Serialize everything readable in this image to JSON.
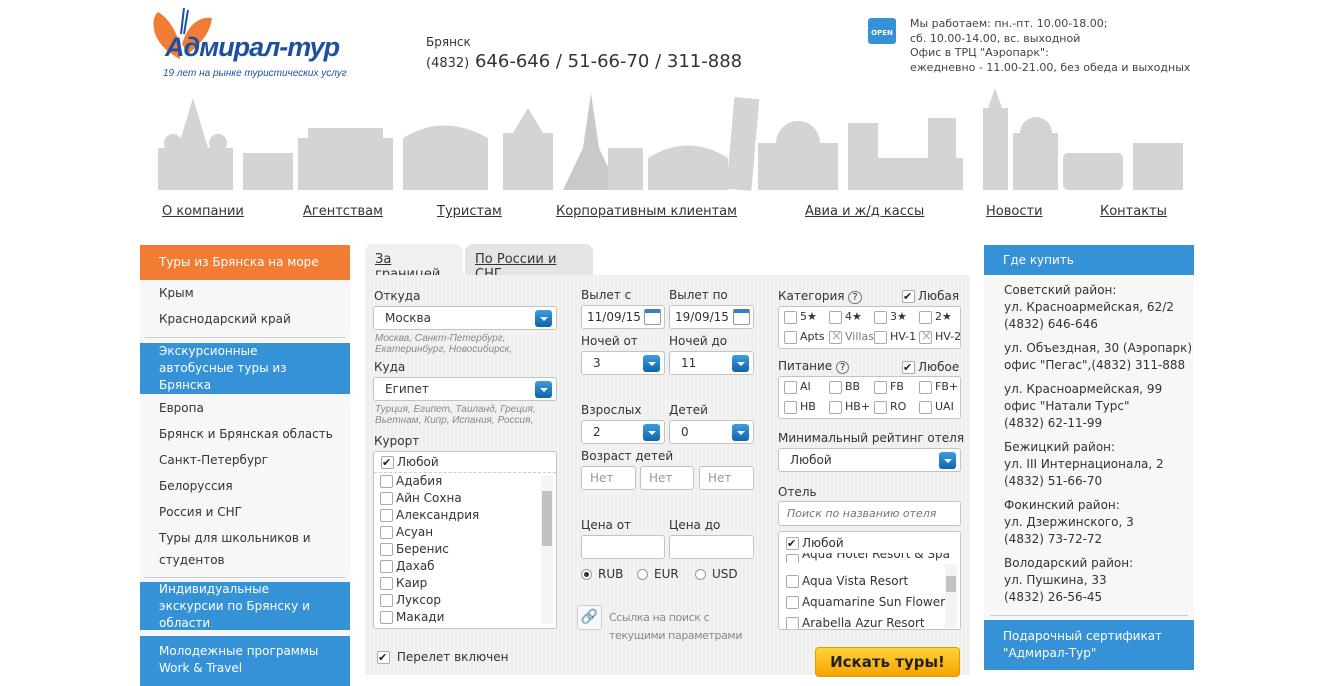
{
  "header": {
    "logo_text": "Адмирал-тур",
    "slogan": "19 лет на рынке туристических услуг",
    "city": "Брянск",
    "phone_code": "(4832)",
    "phones": "646-646 / 51-66-70 / 311-888",
    "open_badge": "OPEN",
    "hours": [
      "Мы работаем: пн.-пт. 10.00-18.00;",
      "сб. 10.00-14.00, вс. выходной",
      "Офис в ТРЦ \"Аэропарк\":",
      "ежедневно - 11.00-21.00, без обеда и выходных"
    ]
  },
  "nav": [
    "О компании",
    "Агентствам",
    "Туристам",
    "Корпоративным клиентам",
    "Авиа и ж/д кассы",
    "Новости",
    "Контакты"
  ],
  "left": {
    "sea_title": "Туры из Брянска на море",
    "sea_items": [
      "Крым",
      "Краснодарский край"
    ],
    "bus_title": "Экскурсионные автобусные туры из Брянска",
    "bus_items": [
      "Европа",
      "Брянск и Брянская область",
      "Санкт-Петербург",
      "Белоруссия",
      "Россия и СНГ",
      "Туры для школьников и студентов"
    ],
    "individual_title": "Индивидуальные экскурсии по Брянску и области",
    "youth_title": "Молодежные программы Work & Travel"
  },
  "search": {
    "tabs": [
      "За границей",
      "По России и СНГ"
    ],
    "from_label": "Откуда",
    "from_value": "Москва",
    "from_hint": "Москва, Санкт-Петербург, Екатеринбург, Новосибирск,",
    "to_label": "Куда",
    "to_value": "Египет",
    "to_hint": "Турция, Египет, Таиланд, Греция, Вьетнам, Кипр, Испания, Россия,",
    "resort_label": "Курорт",
    "resort_any": "Любой",
    "resorts": [
      "Адабия",
      "Айн Сохна",
      "Александрия",
      "Асуан",
      "Беренис",
      "Дахаб",
      "Каир",
      "Луксор",
      "Макади"
    ],
    "flight_included": "Перелет включен",
    "date_from_label": "Вылет с",
    "date_from": "11/09/15",
    "date_to_label": "Вылет по",
    "date_to": "19/09/15",
    "nights_from_label": "Ночей от",
    "nights_from": "3",
    "nights_to_label": "Ночей до",
    "nights_to": "11",
    "adults_label": "Взрослых",
    "adults": "2",
    "children_label": "Детей",
    "children": "0",
    "child_age_label": "Возраст детей",
    "child_age_placeholder": "Нет",
    "price_from_label": "Цена от",
    "price_to_label": "Цена до",
    "currencies": [
      "RUB",
      "EUR",
      "USD"
    ],
    "currency_selected": "RUB",
    "link_text": "Ссылка на поиск с текущими параметрами",
    "category_label": "Категория",
    "category_any": "Любая",
    "categories": [
      "5★",
      "4★",
      "3★",
      "2★",
      "Apts",
      "Villas",
      "HV-1",
      "HV-2"
    ],
    "meal_label": "Питание",
    "meal_any": "Любое",
    "meals": [
      "AI",
      "BB",
      "FB",
      "FB+",
      "HB",
      "HB+",
      "RO",
      "UAI"
    ],
    "rating_label": "Минимальный рейтинг отеля",
    "rating_value": "Любой",
    "hotel_label": "Отель",
    "hotel_placeholder": "Поиск по названию отеля",
    "hotel_any": "Любой",
    "hotels": [
      "Aqua Hotel Resort & Spa",
      "Aqua Vista Resort",
      "Aquamarine Sun Flower R",
      "Arabella Azur Resort"
    ],
    "search_button": "Искать туры!"
  },
  "right": {
    "title": "Где купить",
    "addresses": [
      "Советский район:\nул. Красноармейская, 62/2\n(4832) 646-646",
      "ул. Объездная, 30 (Аэропарк)\nофис \"Пегас\",(4832) 311-888",
      "ул. Красноармейская, 99\nофис \"Натали Турс\"\n(4832) 62-11-99",
      "Бежицкий район:\nул. III Интернационала, 2\n(4832) 51-66-70",
      "Фокинский район:\nул. Дзержинского, 3\n(4832) 73-72-72",
      "Володарский район:\nул. Пушкина, 33\n(4832) 26-56-45"
    ],
    "gift_title": "Подарочный сертификат \"Адмирал-Тур\""
  },
  "colors": {
    "orange": "#f07d33",
    "blue": "#3592d6",
    "logo_blue": "#1e4fa0",
    "button": "#f5b400"
  }
}
